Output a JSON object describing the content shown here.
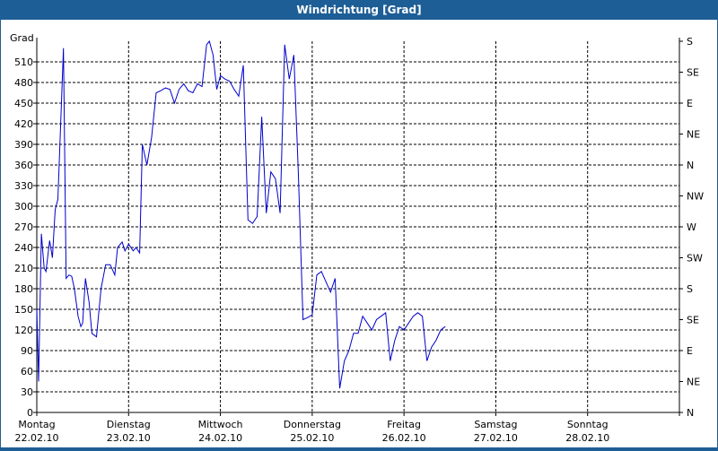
{
  "window": {
    "title": "Windrichtung [Grad]"
  },
  "chart_data": {
    "type": "line",
    "title": "Windrichtung [Grad]",
    "ylabel": "Grad",
    "ylim": [
      0,
      540
    ],
    "y_ticks": [
      0,
      30,
      60,
      90,
      120,
      150,
      180,
      210,
      240,
      270,
      300,
      330,
      360,
      390,
      420,
      450,
      480,
      510
    ],
    "y2_labels": [
      "S",
      "SE",
      "E",
      "NE",
      "N",
      "NW",
      "W",
      "SW",
      "S",
      "SE",
      "E",
      "NE",
      "N"
    ],
    "x_labels": [
      {
        "day": "Montag",
        "date": "22.02.10"
      },
      {
        "day": "Dienstag",
        "date": "23.02.10"
      },
      {
        "day": "Mittwoch",
        "date": "24.02.10"
      },
      {
        "day": "Donnerstag",
        "date": "25.02.10"
      },
      {
        "day": "Freitag",
        "date": "26.02.10"
      },
      {
        "day": "Samstag",
        "date": "27.02.10"
      },
      {
        "day": "Sonntag",
        "date": "28.02.10"
      }
    ],
    "xlim": [
      0,
      7
    ],
    "grid": true,
    "line_color": "#0000cc",
    "series": [
      {
        "x": [
          0.0,
          0.02,
          0.05,
          0.08,
          0.1,
          0.14,
          0.17,
          0.2,
          0.23,
          0.26,
          0.29,
          0.32,
          0.35,
          0.38,
          0.41,
          0.45,
          0.48,
          0.5,
          0.53,
          0.57,
          0.6,
          0.65,
          0.7,
          0.75,
          0.8,
          0.85,
          0.88,
          0.93,
          0.96,
          1.0,
          1.05,
          1.08,
          1.12,
          1.15,
          1.2,
          1.25,
          1.3,
          1.35,
          1.4,
          1.45,
          1.5,
          1.55,
          1.6,
          1.65,
          1.7,
          1.75,
          1.8,
          1.85,
          1.88,
          1.92,
          1.96,
          2.0,
          2.05,
          2.1,
          2.15,
          2.2,
          2.25,
          2.3,
          2.35,
          2.4,
          2.45,
          2.5,
          2.55,
          2.6,
          2.65,
          2.7,
          2.75,
          2.8,
          2.85,
          2.9,
          2.95,
          3.0,
          3.05,
          3.1,
          3.15,
          3.2,
          3.25,
          3.3,
          3.35,
          3.4,
          3.45,
          3.5,
          3.55,
          3.6,
          3.65,
          3.7,
          3.75,
          3.8,
          3.85,
          3.9,
          3.95,
          4.0,
          4.05,
          4.1,
          4.15,
          4.2,
          4.25,
          4.3,
          4.35,
          4.4,
          4.45
        ],
        "y": [
          150,
          45,
          260,
          210,
          205,
          250,
          225,
          295,
          310,
          420,
          530,
          195,
          200,
          198,
          180,
          140,
          125,
          130,
          195,
          160,
          115,
          110,
          180,
          215,
          215,
          200,
          240,
          248,
          235,
          245,
          235,
          240,
          232,
          390,
          360,
          400,
          465,
          468,
          472,
          470,
          450,
          470,
          478,
          468,
          465,
          478,
          474,
          535,
          540,
          520,
          470,
          490,
          485,
          482,
          470,
          460,
          505,
          280,
          275,
          285,
          430,
          290,
          350,
          340,
          290,
          535,
          485,
          520,
          345,
          135,
          138,
          142,
          200,
          205,
          190,
          175,
          195,
          35,
          75,
          90,
          115,
          115,
          140,
          130,
          120,
          135,
          140,
          145,
          75,
          105,
          125,
          120,
          130,
          140,
          145,
          140,
          75,
          95,
          105,
          120,
          125
        ]
      }
    ]
  }
}
